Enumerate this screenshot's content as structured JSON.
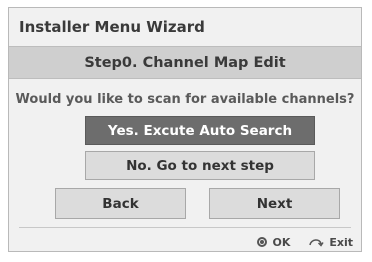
{
  "dialog": {
    "title": "Installer Menu Wizard",
    "step_title": "Step0. Channel Map Edit",
    "question": "Would you like to scan for available channels?"
  },
  "options": {
    "auto_search_label": "Yes. Excute Auto Search",
    "next_step_label": "No. Go to next step",
    "selected": "auto_search"
  },
  "nav": {
    "back_label": "Back",
    "next_label": "Next"
  },
  "footer": {
    "ok_icon": "ok-button-icon",
    "ok_label": "OK",
    "exit_icon": "return-arrow-icon",
    "exit_label": "Exit"
  },
  "colors": {
    "panel_bg": "#f1f1f1",
    "step_bar_bg": "#cfcfcf",
    "selected_bg": "#6d6d6d",
    "button_bg": "#dcdcdc",
    "text": "#3a3a3a"
  }
}
